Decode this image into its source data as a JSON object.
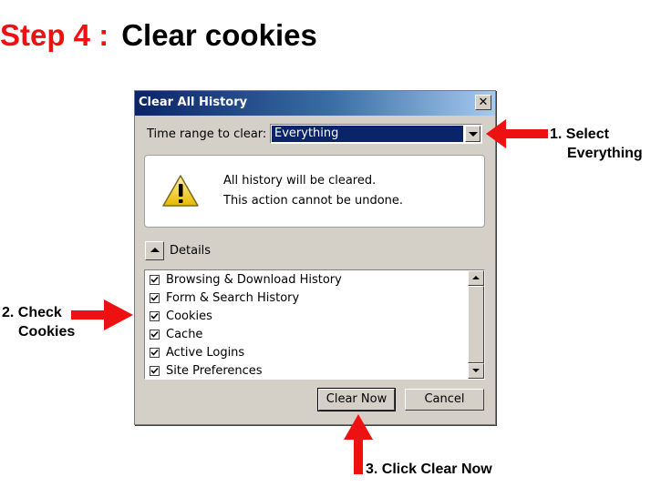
{
  "heading": {
    "step": "Step 4 :",
    "title": "Clear cookies"
  },
  "dialog": {
    "title": "Clear All History",
    "close_glyph": "✕",
    "time_range_label": "Time range to clear:",
    "time_range_value": "Everything",
    "warning_line1": "All history will be cleared.",
    "warning_line2": "This action cannot be undone.",
    "details_label": "Details",
    "items": [
      {
        "label": "Browsing & Download History",
        "checked": true
      },
      {
        "label": "Form & Search History",
        "checked": true
      },
      {
        "label": "Cookies",
        "checked": true
      },
      {
        "label": "Cache",
        "checked": true
      },
      {
        "label": "Active Logins",
        "checked": true
      },
      {
        "label": "Site Preferences",
        "checked": true
      }
    ],
    "clear_now_label": "Clear Now",
    "cancel_label": "Cancel"
  },
  "annotations": {
    "select_line1": "1. Select",
    "select_line2": "Everything",
    "check_line1": "2. Check",
    "check_line2": "Cookies",
    "click": "3. Click Clear Now"
  },
  "colors": {
    "accent_red": "#ee1111",
    "titlebar": "#0a246a",
    "dialog_bg": "#d4d0c8",
    "warning_yellow": "#f5c518"
  },
  "icons": {
    "warning": "warning-triangle-icon",
    "checkbox": "checkmark-icon"
  }
}
